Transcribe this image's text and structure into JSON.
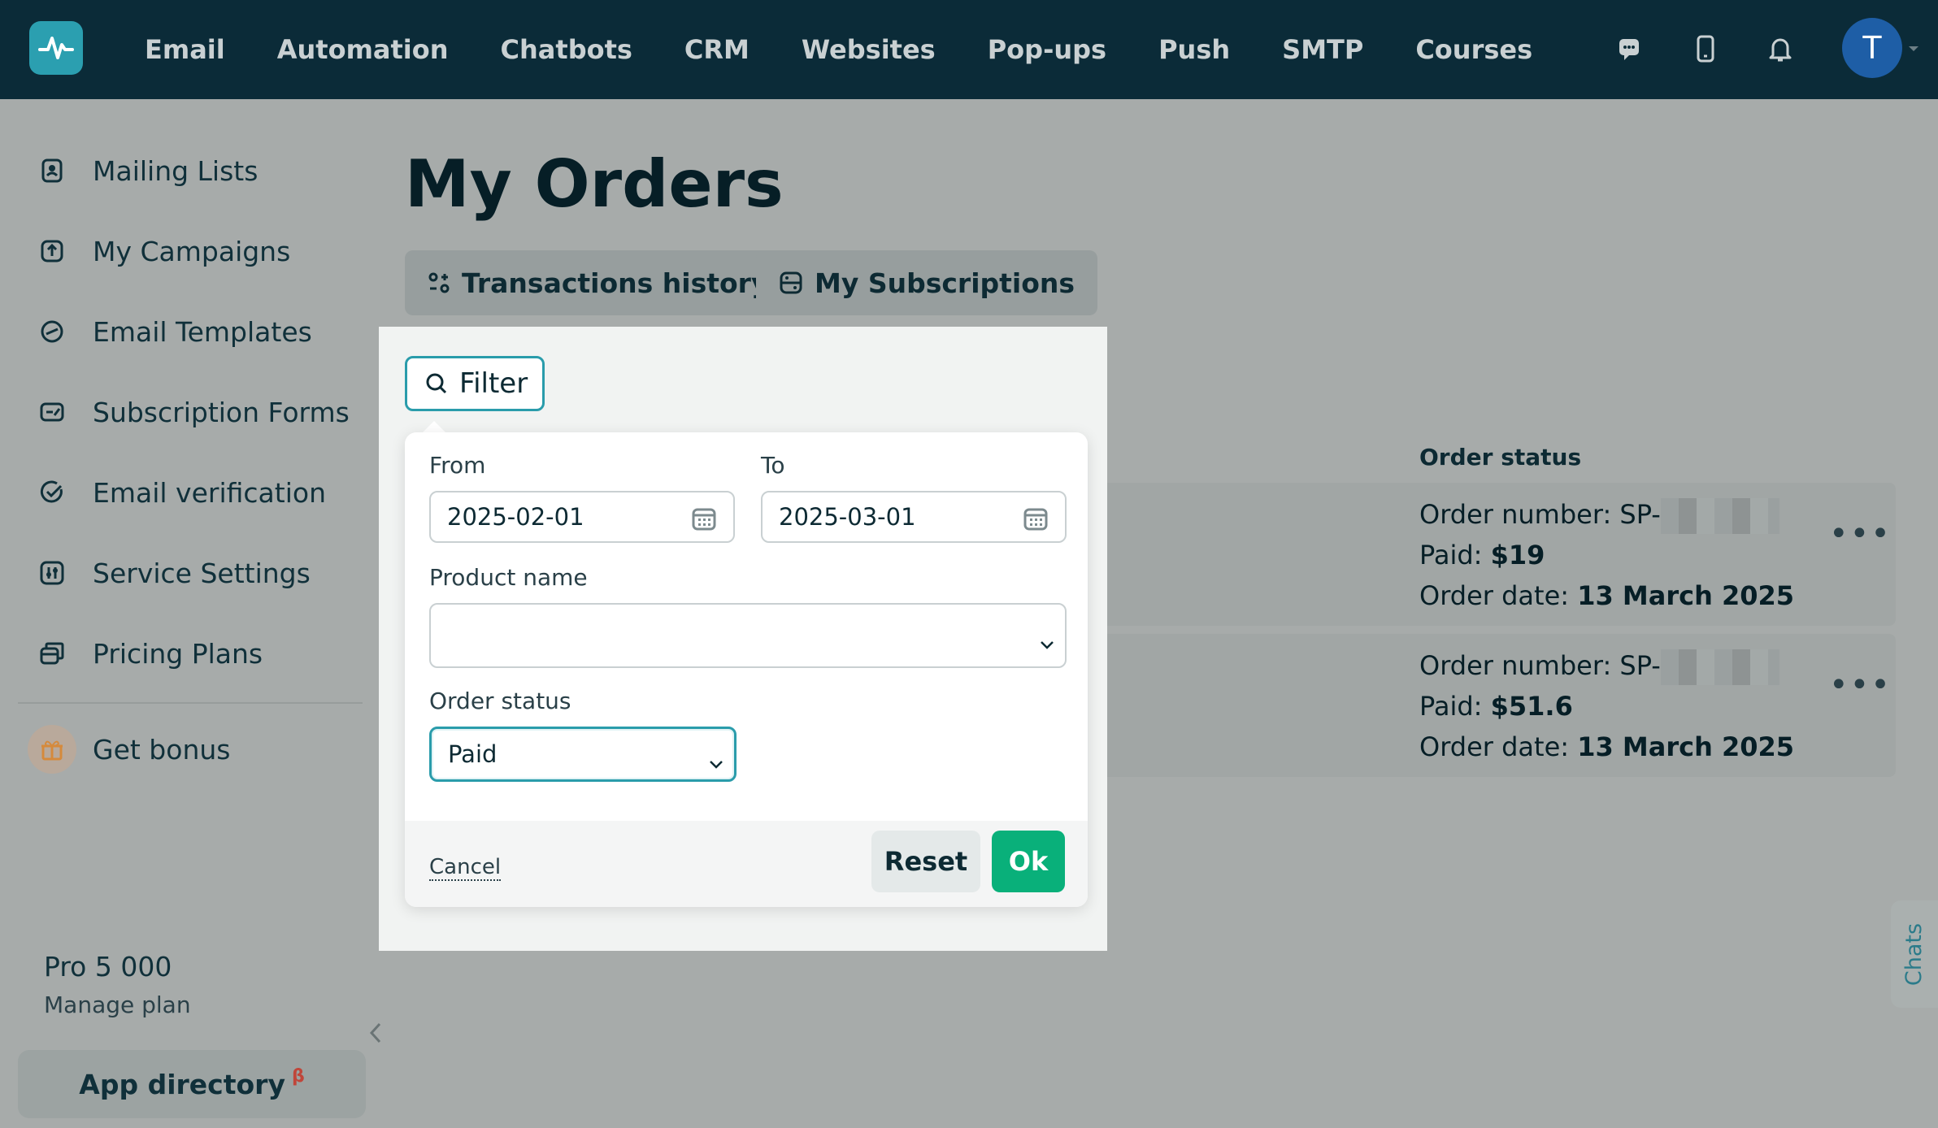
{
  "nav": {
    "items": [
      "Email",
      "Automation",
      "Chatbots",
      "CRM",
      "Websites",
      "Pop-ups",
      "Push",
      "SMTP",
      "Courses"
    ],
    "avatar_letter": "T"
  },
  "sidebar": {
    "items": [
      {
        "label": "Mailing Lists",
        "icon": "contacts-icon"
      },
      {
        "label": "My Campaigns",
        "icon": "upload-icon"
      },
      {
        "label": "Email Templates",
        "icon": "template-icon"
      },
      {
        "label": "Subscription Forms",
        "icon": "form-icon"
      },
      {
        "label": "Email verification",
        "icon": "check-circle-icon"
      },
      {
        "label": "Service Settings",
        "icon": "settings-sliders-icon"
      },
      {
        "label": "Pricing Plans",
        "icon": "cards-icon"
      }
    ],
    "bonus_label": "Get bonus",
    "plan_name": "Pro 5 000",
    "manage_plan": "Manage plan",
    "app_directory": "App directory",
    "app_directory_badge": "β"
  },
  "page": {
    "title": "My Orders",
    "tabs": [
      "Transactions history",
      "My Subscriptions"
    ],
    "column_header": "Order status"
  },
  "orders": [
    {
      "number_prefix": "Order number: SP-",
      "paid_label": "Paid: ",
      "paid": "$19",
      "date_label": "Order date: ",
      "date": "13 March 2025"
    },
    {
      "number_prefix": "Order number: SP-",
      "paid_label": "Paid: ",
      "paid": "$51.6",
      "date_label": "Order date: ",
      "date": "13 March 2025"
    }
  ],
  "filter": {
    "button_label": "Filter",
    "from_label": "From",
    "from_value": "2025-02-01",
    "to_label": "To",
    "to_value": "2025-03-01",
    "product_label": "Product name",
    "product_value": "",
    "status_label": "Order status",
    "status_value": "Paid",
    "cancel": "Cancel",
    "reset": "Reset",
    "ok": "Ok"
  },
  "chats_tab": "Chats",
  "colors": {
    "topbar": "#0b2b38",
    "accent": "#2a9cab",
    "ok": "#09b07a"
  }
}
